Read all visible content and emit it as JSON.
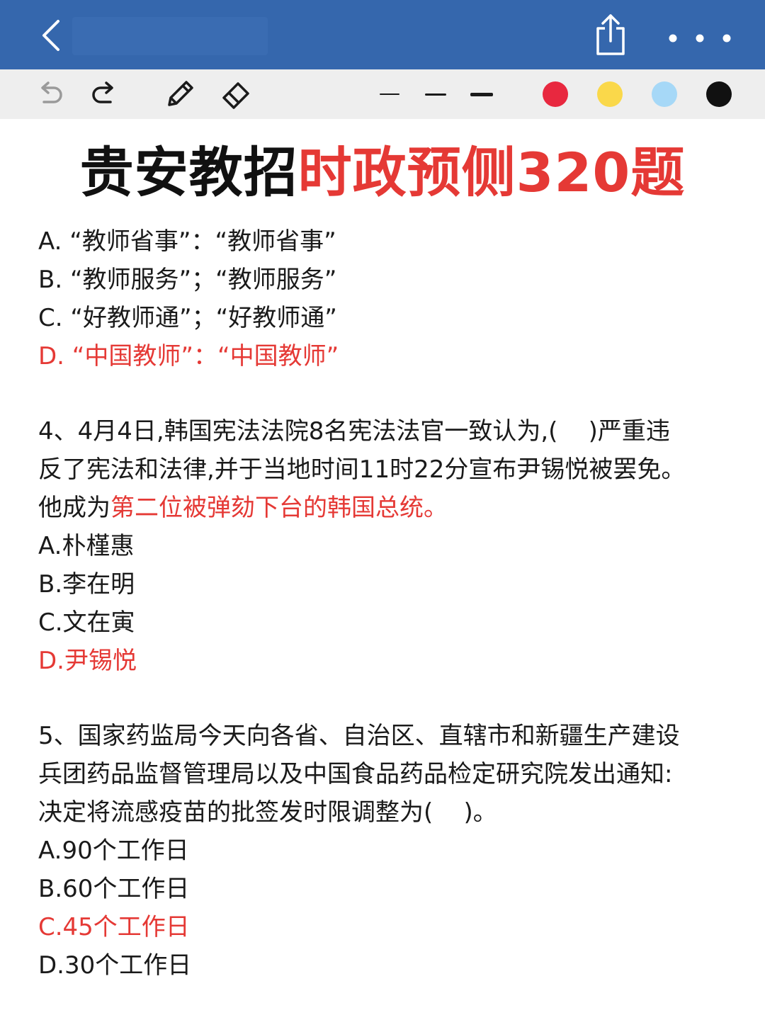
{
  "nav": {
    "back_icon": "chevron-left-icon",
    "share_icon": "share-icon",
    "more_icon": "more-horizontal-icon"
  },
  "toolbar": {
    "tools": [
      "undo-icon",
      "redo-icon",
      "pen-icon",
      "eraser-icon"
    ],
    "strokes": [
      "thin",
      "medium",
      "thick"
    ],
    "colors": [
      "#e8283f",
      "#fad84a",
      "#a6d8f7",
      "#111111"
    ]
  },
  "headline": {
    "black_part": "贵安教招",
    "red_part": "时政预侧320题"
  },
  "q3": {
    "options": [
      "A. “教师省事”：“教师省事”",
      "B. “教师服务”；“教师服务”",
      "C. “好教师通”；“好教师通”"
    ],
    "answer": "D. “中国教师”：“中国教师”"
  },
  "q4": {
    "line1": "4、4月4日,韩国宪法法院8名宪法法官一致认为,(    )严重违",
    "line2": "反了宪法和法律,并于当地时间11时22分宣布尹锡悦被罢免。",
    "line3_prefix": "他成为",
    "line3_highlight": "第二位被弹劾下台的韩国总统。",
    "options": [
      "A.朴槿惠",
      "B.李在明",
      "C.文在寅"
    ],
    "answer": "D.尹锡悦"
  },
  "q5": {
    "line1": "5、国家药监局今天向各省、自治区、直辖市和新疆生产建设",
    "line2": "兵团药品监督管理局以及中国食品药品检定研究院发出通知:",
    "line3": "决定将流感疫苗的批签发时限调整为(    )。",
    "option_a": "A.90个工作日",
    "option_b": "B.60个工作日",
    "answer": "C.45个工作日",
    "option_d": "D.30个工作日"
  }
}
